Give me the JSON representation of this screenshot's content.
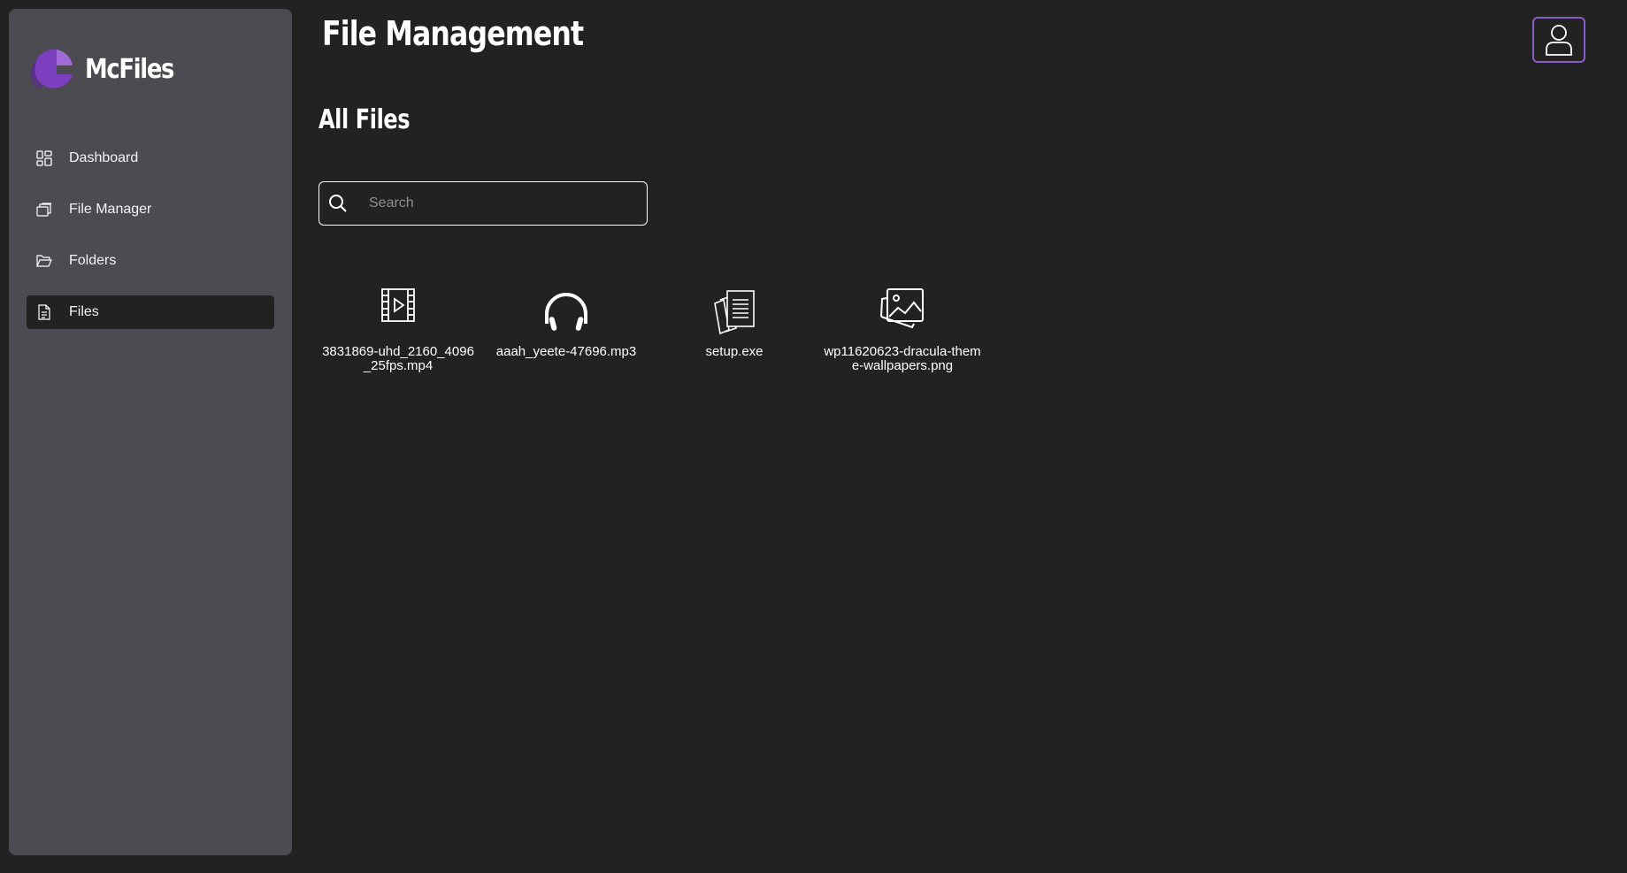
{
  "brand": {
    "name": "McFiles",
    "logo_icon": "crescent-logo-icon",
    "accent": "#7b3fbf"
  },
  "header": {
    "title": "File Management",
    "avatar_icon": "user-icon"
  },
  "sidebar": {
    "items": [
      {
        "label": "Dashboard",
        "icon": "dashboard-grid-icon",
        "active": false
      },
      {
        "label": "File Manager",
        "icon": "stacked-files-icon",
        "active": false
      },
      {
        "label": "Folders",
        "icon": "folder-open-icon",
        "active": false
      },
      {
        "label": "Files",
        "icon": "document-icon",
        "active": true
      }
    ]
  },
  "main": {
    "section_title": "All Files",
    "search": {
      "placeholder": "Search",
      "value": ""
    },
    "files": [
      {
        "name": "3831869-uhd_2160_4096_25fps.mp4",
        "icon": "video-file-icon"
      },
      {
        "name": "aaah_yeete-47696.mp3",
        "icon": "headphones-icon"
      },
      {
        "name": "setup.exe",
        "icon": "documents-stack-icon"
      },
      {
        "name": "wp11620623-dracula-theme-wallpapers.png",
        "icon": "image-icon"
      }
    ]
  },
  "colors": {
    "background": "#222222",
    "sidebar": "#4d4b52",
    "active_item": "#222222",
    "avatar_border": "#8b5cc7"
  }
}
